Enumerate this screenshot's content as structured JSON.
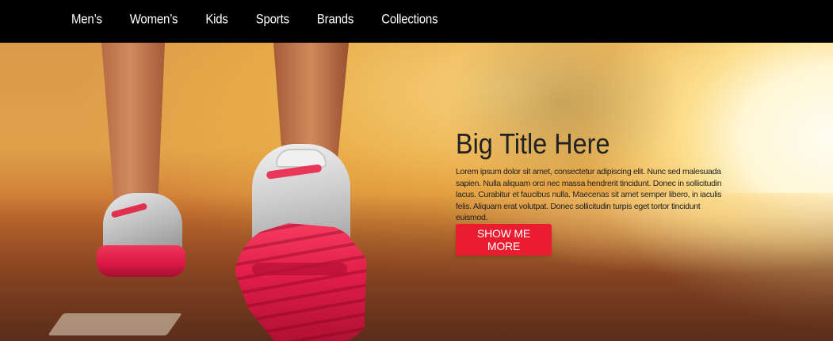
{
  "nav": {
    "items": [
      {
        "label": "Men’s"
      },
      {
        "label": "Women’s"
      },
      {
        "label": "Kids"
      },
      {
        "label": "Sports"
      },
      {
        "label": "Brands"
      },
      {
        "label": "Collections"
      }
    ]
  },
  "hero": {
    "title": "Big Title Here",
    "body": "Lorem ipsum dolor sit amet, consectetur adipiscing elit. Nunc sed malesuada sapien. Nulla aliquam orci nec massa hendrerit tincidunt. Donec in sollicitudin lacus. Curabitur et faucibus nulla. Maecenas sit amet semper libero, in iaculis felis. Aliquam erat volutpat. Donec sollicitudin turpis eget tortor tincidunt euismod.",
    "button_label": "SHOW ME MORE",
    "image": "running-shoes-sunrise-photo"
  },
  "colors": {
    "navbar_bg": "#000000",
    "accent_button": "#ea1d30",
    "title_text": "#222222"
  }
}
